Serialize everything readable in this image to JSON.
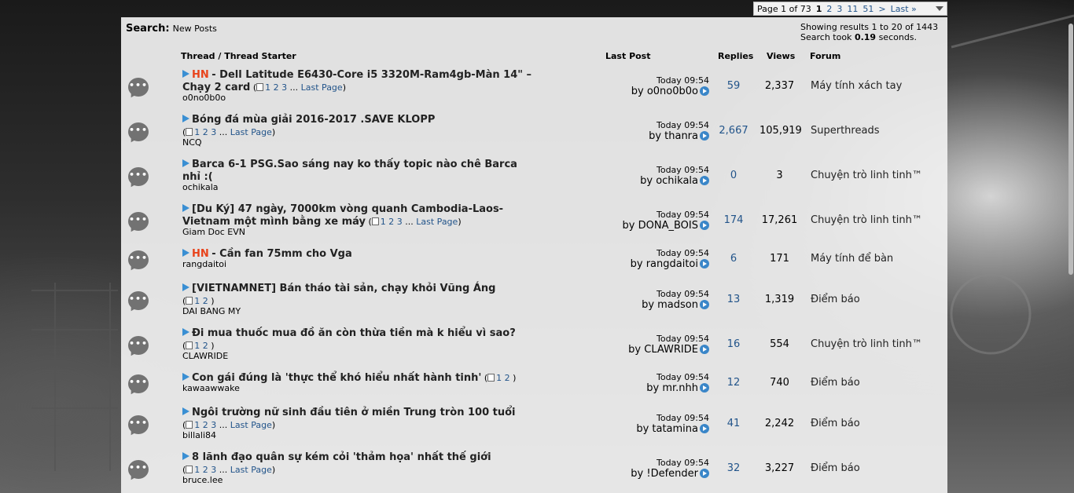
{
  "pager": {
    "label": "Page 1 of 73",
    "current": "1",
    "links": [
      "2",
      "3",
      "11",
      "51",
      ">",
      "Last »"
    ]
  },
  "search": {
    "label": "Search:",
    "query": "New Posts"
  },
  "results": {
    "showing": "Showing results 1 to 20 of 1443",
    "took_prefix": "Search took",
    "took_value": "0.19",
    "took_suffix": "seconds."
  },
  "columns": {
    "thread": "Thread / Thread Starter",
    "last_post": "Last Post",
    "replies": "Replies",
    "views": "Views",
    "forum": "Forum"
  },
  "pages_last_label": "Last Page",
  "threads": [
    {
      "prefix": "HN",
      "title": "- Dell Latitude E6430-Core i5 3320M-Ram4gb-Màn 14\" – Chạy 2 card",
      "pages": [
        "1",
        "2",
        "3"
      ],
      "has_last": true,
      "starter": "o0no0b0o",
      "time": "Today 09:54",
      "by": "o0no0b0o",
      "replies": "59",
      "views": "2,337",
      "forum": "Máy tính xách tay"
    },
    {
      "prefix": "",
      "title": "Bóng đá mùa giải 2016-2017 .SAVE KLOPP",
      "pages": [
        "1",
        "2",
        "3"
      ],
      "has_last": true,
      "starter": "NCQ",
      "time": "Today 09:54",
      "by": "thanra",
      "replies": "2,667",
      "views": "105,919",
      "forum": "Superthreads"
    },
    {
      "prefix": "",
      "title": "Barca 6-1 PSG.Sao sáng nay ko thấy topic nào chê Barca nhỉ :(",
      "pages": [],
      "has_last": false,
      "starter": "ochikala",
      "time": "Today 09:54",
      "by": "ochikala",
      "replies": "0",
      "views": "3",
      "forum": "Chuyện trò linh tinh™"
    },
    {
      "prefix": "",
      "title": "[Du Ký] 47 ngày, 7000km vòng quanh Cambodia-Laos-Vietnam một mình bằng xe máy",
      "pages": [
        "1",
        "2",
        "3"
      ],
      "has_last": true,
      "starter": "Giam Doc EVN",
      "time": "Today 09:54",
      "by": "DONA_BOIS",
      "replies": "174",
      "views": "17,261",
      "forum": "Chuyện trò linh tinh™"
    },
    {
      "prefix": "HN",
      "title": "- Cần fan 75mm cho Vga",
      "pages": [],
      "has_last": false,
      "starter": "rangdaitoi",
      "time": "Today 09:54",
      "by": "rangdaitoi",
      "replies": "6",
      "views": "171",
      "forum": "Máy tính để bàn"
    },
    {
      "prefix": "",
      "title": "[VIETNAMNET] Bán tháo tài sản, chạy khỏi Vũng Áng",
      "pages": [
        "1",
        "2"
      ],
      "has_last": false,
      "starter": "DAI BANG MY",
      "time": "Today 09:54",
      "by": "madson",
      "replies": "13",
      "views": "1,319",
      "forum": "Điểm báo"
    },
    {
      "prefix": "",
      "title": "Đi mua thuốc mua đồ ăn còn thừa tiền mà k hiểu vì sao?",
      "pages": [
        "1",
        "2"
      ],
      "has_last": false,
      "starter": "CLAWRIDE",
      "time": "Today 09:54",
      "by": "CLAWRIDE",
      "replies": "16",
      "views": "554",
      "forum": "Chuyện trò linh tinh™"
    },
    {
      "prefix": "",
      "title": "Con gái đúng là 'thực thể khó hiểu nhất hành tinh'",
      "pages": [
        "1",
        "2"
      ],
      "has_last": false,
      "starter": "kawaawwake",
      "time": "Today 09:54",
      "by": "mr.nhh",
      "replies": "12",
      "views": "740",
      "forum": "Điểm báo"
    },
    {
      "prefix": "",
      "title": "Ngôi trường nữ sinh đầu tiên ở miền Trung tròn 100 tuổi",
      "pages": [
        "1",
        "2",
        "3"
      ],
      "has_last": true,
      "starter": "billali84",
      "time": "Today 09:54",
      "by": "tatamina",
      "replies": "41",
      "views": "2,242",
      "forum": "Điểm báo"
    },
    {
      "prefix": "",
      "title": "8 lãnh đạo quân sự kém cỏi 'thảm họa' nhất thế giới",
      "pages": [
        "1",
        "2",
        "3"
      ],
      "has_last": true,
      "starter": "bruce.lee",
      "time": "Today 09:54",
      "by": "!Defender",
      "replies": "32",
      "views": "3,227",
      "forum": "Điểm báo"
    }
  ]
}
